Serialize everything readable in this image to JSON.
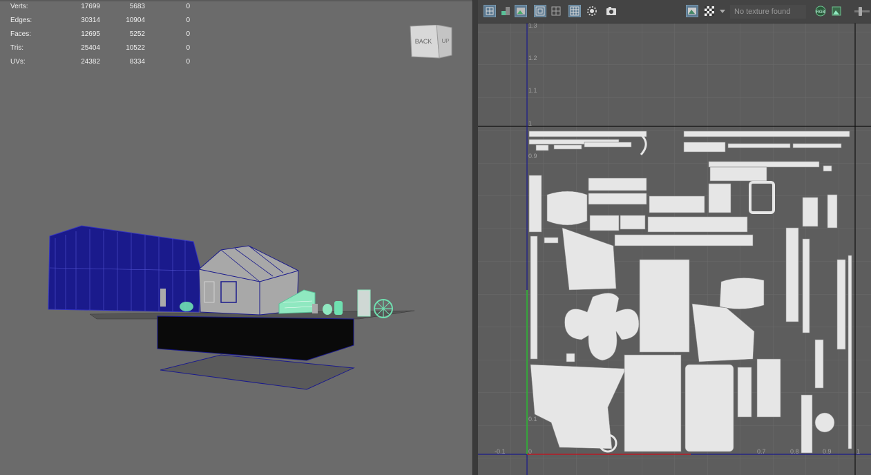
{
  "stats": {
    "rows": [
      {
        "label": "Verts:",
        "v1": "17699",
        "v2": "5683",
        "v3": "0"
      },
      {
        "label": "Edges:",
        "v1": "30314",
        "v2": "10904",
        "v3": "0"
      },
      {
        "label": "Faces:",
        "v1": "12695",
        "v2": "5252",
        "v3": "0"
      },
      {
        "label": "Tris:",
        "v1": "25404",
        "v2": "10522",
        "v3": "0"
      },
      {
        "label": "UVs:",
        "v1": "24382",
        "v2": "8334",
        "v3": "0"
      }
    ]
  },
  "viewcube": {
    "back_label": "BACK",
    "up_label": "UP"
  },
  "uv_toolbar": {
    "texture_status": "No texture found",
    "rgb_label": "RGB"
  },
  "uv_axis": {
    "v_labels": [
      "1.3",
      "1.2",
      "1.1",
      "1",
      "0.9"
    ],
    "u_labels": [
      "-0.1",
      "0",
      "0.7",
      "0.8",
      "0.9",
      "1"
    ],
    "v_dim_labels": [
      "0.1"
    ]
  },
  "colors": {
    "viewport_bg": "#6b6b6b",
    "uv_bg": "#5d5d5d",
    "wire": "#1a1a8c",
    "selected": "#6fe0b0",
    "shell": "#e6e6e6"
  }
}
